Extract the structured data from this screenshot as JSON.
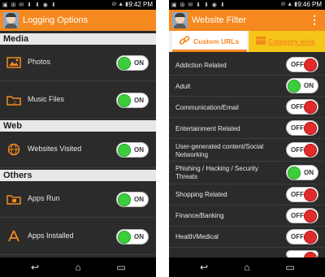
{
  "left": {
    "status": {
      "time": "9:42 PM"
    },
    "app_title": "Logging Options",
    "sections": [
      {
        "title": "Media",
        "rows": [
          {
            "label": "Photos",
            "icon": "photo-icon",
            "state": "ON"
          },
          {
            "label": "Music Files",
            "icon": "music-folder-icon",
            "state": "ON"
          }
        ]
      },
      {
        "title": "Web",
        "rows": [
          {
            "label": "Websites Visited",
            "icon": "globe-icon",
            "state": "ON"
          }
        ]
      },
      {
        "title": "Others",
        "rows": [
          {
            "label": "Apps Run",
            "icon": "apps-folder-icon",
            "state": "ON"
          },
          {
            "label": "Apps Installed",
            "icon": "app-store-icon",
            "state": "ON"
          }
        ]
      }
    ]
  },
  "right": {
    "status": {
      "time": "9:46 PM"
    },
    "app_title": "Website Filter",
    "tabs": [
      {
        "label": "Custom URLs",
        "active": true
      },
      {
        "label": "Category wise",
        "active": false
      }
    ],
    "rows": [
      {
        "label": "Addiction Related",
        "state": "OFF"
      },
      {
        "label": "Adult",
        "state": "ON"
      },
      {
        "label": "Communication/Email",
        "state": "OFF"
      },
      {
        "label": "Entertainment Related",
        "state": "OFF"
      },
      {
        "label": "User-generated content/Social Networking",
        "state": "OFF"
      },
      {
        "label": "Phishing / Hacking / Security Threats",
        "state": "ON"
      },
      {
        "label": "Shopping Related",
        "state": "OFF"
      },
      {
        "label": "Finance/Banking",
        "state": "OFF"
      },
      {
        "label": "Health/Medical",
        "state": "OFF"
      }
    ]
  },
  "colors": {
    "accent": "#f5891f",
    "on": "#3ccd3c",
    "off": "#e12b2b",
    "background": "#2b2b2b"
  }
}
